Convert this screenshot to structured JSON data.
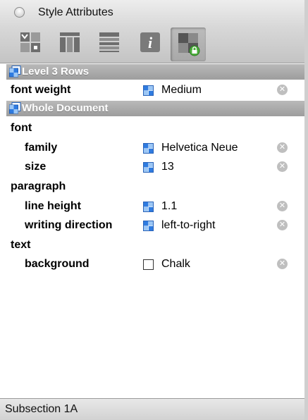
{
  "window": {
    "title": "Style Attributes"
  },
  "toolbar": {
    "buttons": [
      {
        "icon": "grid-style-icon",
        "selected": false
      },
      {
        "icon": "columns-style-icon",
        "selected": false
      },
      {
        "icon": "rows-style-icon",
        "selected": false
      },
      {
        "icon": "info-icon",
        "selected": false
      },
      {
        "icon": "locked-style-icon",
        "selected": true
      }
    ]
  },
  "sections": [
    {
      "label": "Level 3 Rows",
      "rows": [
        {
          "key": "font weight",
          "indent": 0,
          "swatch": "blue",
          "value": "Medium",
          "removable": true
        }
      ]
    },
    {
      "label": "Whole Document",
      "rows": [
        {
          "key": "font",
          "indent": 0
        },
        {
          "key": "family",
          "indent": 1,
          "swatch": "blue",
          "value": "Helvetica Neue",
          "removable": true
        },
        {
          "key": "size",
          "indent": 1,
          "swatch": "blue",
          "value": "13",
          "removable": true
        },
        {
          "key": "paragraph",
          "indent": 0
        },
        {
          "key": "line height",
          "indent": 1,
          "swatch": "blue",
          "value": "1.1",
          "removable": true
        },
        {
          "key": "writing direction",
          "indent": 1,
          "swatch": "blue",
          "value": "left-to-right",
          "removable": true
        },
        {
          "key": "text",
          "indent": 0
        },
        {
          "key": "background",
          "indent": 1,
          "swatch": "white",
          "value": "Chalk",
          "removable": true
        }
      ]
    }
  ],
  "status": {
    "text": "Subsection 1A"
  },
  "colors": {
    "section_header": "#a9a9a9",
    "swatch_blue": "#2f7be0",
    "remove_button": "#bfbfbf"
  }
}
